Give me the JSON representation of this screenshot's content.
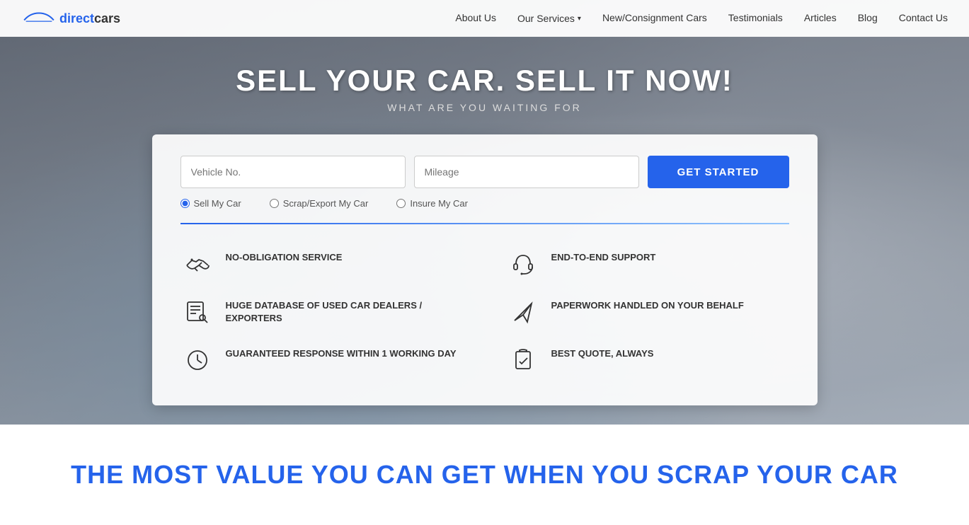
{
  "nav": {
    "logo_text_part1": "direct",
    "logo_text_part2": "cars",
    "items": [
      {
        "label": "About Us",
        "href": "#",
        "has_dropdown": false
      },
      {
        "label": "Our Services",
        "href": "#",
        "has_dropdown": true
      },
      {
        "label": "New/Consignment Cars",
        "href": "#",
        "has_dropdown": false
      },
      {
        "label": "Testimonials",
        "href": "#",
        "has_dropdown": false
      },
      {
        "label": "Articles",
        "href": "#",
        "has_dropdown": false
      },
      {
        "label": "Blog",
        "href": "#",
        "has_dropdown": false
      },
      {
        "label": "Contact Us",
        "href": "#",
        "has_dropdown": false
      }
    ]
  },
  "hero": {
    "title": "SELL YOUR CAR. SELL IT NOW!",
    "subtitle": "WHAT ARE YOU WAITING FOR"
  },
  "form": {
    "vehicle_placeholder": "Vehicle No.",
    "mileage_placeholder": "Mileage",
    "cta_label": "GET STARTED",
    "radio_options": [
      {
        "label": "Sell My Car",
        "value": "sell"
      },
      {
        "label": "Scrap/Export My Car",
        "value": "scrap"
      },
      {
        "label": "Insure My Car",
        "value": "insure"
      }
    ]
  },
  "features": [
    {
      "icon": "handshake-icon",
      "text": "NO-OBLIGATION SERVICE",
      "side": "left"
    },
    {
      "icon": "headset-icon",
      "text": "END-TO-END SUPPORT",
      "side": "right"
    },
    {
      "icon": "database-icon",
      "text": "HUGE DATABASE OF USED CAR DEALERS / EXPORTERS",
      "side": "left"
    },
    {
      "icon": "paperplane-icon",
      "text": "PAPERWORK HANDLED ON YOUR BEHALF",
      "side": "right"
    },
    {
      "icon": "clock-icon",
      "text": "GUARANTEED RESPONSE WITHIN 1 WORKING DAY",
      "side": "left"
    },
    {
      "icon": "clipboard-icon",
      "text": "BEST QUOTE, ALWAYS",
      "side": "right"
    }
  ],
  "bottom": {
    "title": "THE MOST VALUE YOU CAN GET WHEN YOU SCRAP YOUR CAR"
  }
}
